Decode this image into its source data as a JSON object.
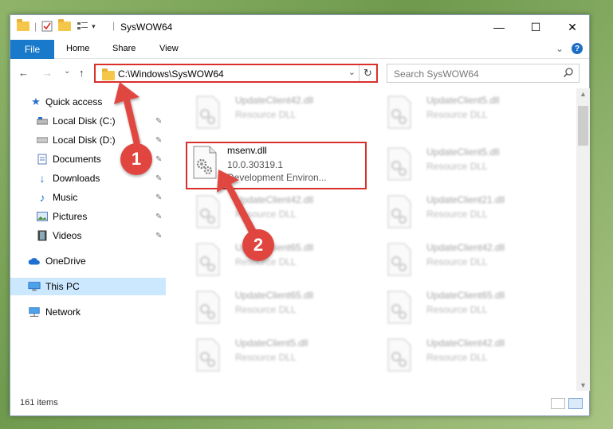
{
  "window": {
    "title": "SysWOW64",
    "minimize_glyph": "—",
    "maximize_glyph": "☐",
    "close_glyph": "✕"
  },
  "ribbon": {
    "file": "File",
    "home": "Home",
    "share": "Share",
    "view": "View",
    "help_glyph": "?",
    "expand_glyph": "⌄"
  },
  "nav": {
    "back_glyph": "←",
    "forward_glyph": "→",
    "recent_glyph": "⌄",
    "up_glyph": "↑",
    "address": "C:\\Windows\\SysWOW64",
    "address_dropdown_glyph": "⌄",
    "refresh_glyph": "↻",
    "search_placeholder": "Search SysWOW64"
  },
  "sidebar": {
    "items": [
      {
        "label": "Quick access",
        "icon": "star-icon",
        "pinned": false
      },
      {
        "label": "Local Disk (C:)",
        "icon": "drive-icon",
        "pinned": true
      },
      {
        "label": "Local Disk (D:)",
        "icon": "drive-icon",
        "pinned": true
      },
      {
        "label": "Documents",
        "icon": "documents-icon",
        "pinned": true
      },
      {
        "label": "Downloads",
        "icon": "download-icon",
        "pinned": true
      },
      {
        "label": "Music",
        "icon": "music-icon",
        "pinned": true
      },
      {
        "label": "Pictures",
        "icon": "pictures-icon",
        "pinned": true
      },
      {
        "label": "Videos",
        "icon": "videos-icon",
        "pinned": true
      },
      {
        "label": "OneDrive",
        "icon": "cloud-icon",
        "pinned": false
      },
      {
        "label": "This PC",
        "icon": "computer-icon",
        "pinned": false,
        "selected": true
      },
      {
        "label": "Network",
        "icon": "network-icon",
        "pinned": false
      }
    ],
    "pin_glyph": "📌"
  },
  "files": [
    {
      "name": "UpdateClient42.dll",
      "type": "Resource DLL"
    },
    {
      "name": "UpdateClient5.dll",
      "type": "Resource DLL"
    },
    {
      "name": "msenv.dll",
      "version": "10.0.30319.1",
      "type": "Development Environ...",
      "highlighted": true
    },
    {
      "name": "UpdateClient5.dll",
      "type": "Resource DLL"
    },
    {
      "name": "UpdateClient42.dll",
      "type": "Resource DLL"
    },
    {
      "name": "UpdateClient21.dll",
      "type": "Resource DLL"
    },
    {
      "name": "UpdateClient65.dll",
      "type": "Resource DLL"
    },
    {
      "name": "UpdateClient42.dll",
      "type": "Resource DLL"
    },
    {
      "name": "UpdateClient65.dll",
      "type": "Resource DLL"
    },
    {
      "name": "UpdateClient65.dll",
      "type": "Resource DLL"
    },
    {
      "name": "UpdateClient5.dll",
      "type": "Resource DLL"
    },
    {
      "name": "UpdateClient42.dll",
      "type": "Resource DLL"
    }
  ],
  "status": {
    "item_count": "161 items"
  },
  "annotations": {
    "step1": "1",
    "step2": "2",
    "color": "#e0463f"
  }
}
